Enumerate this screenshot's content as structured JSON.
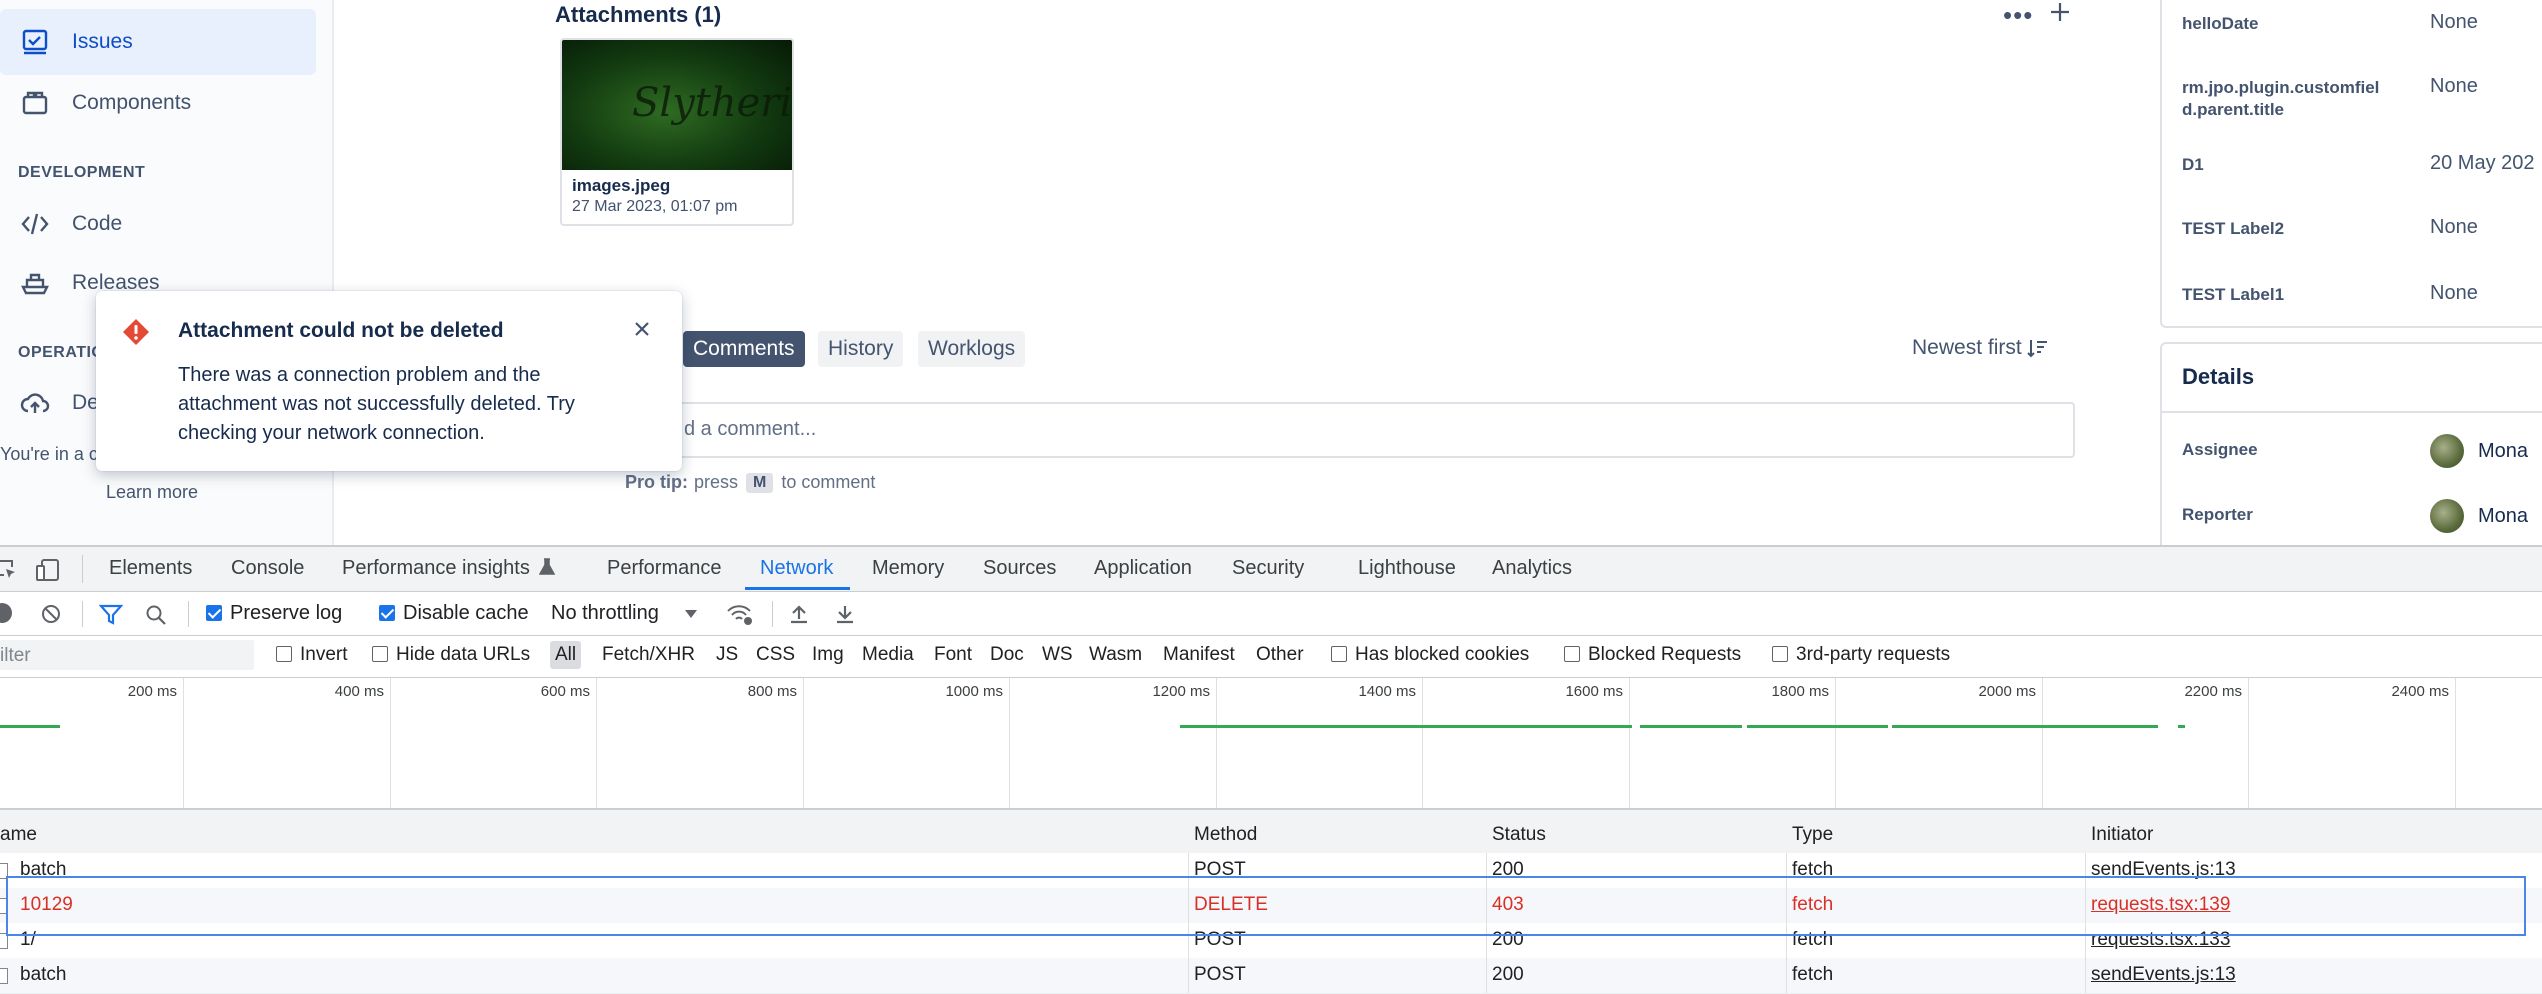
{
  "sidebar": {
    "items": [
      {
        "label": "Issues",
        "icon": "issues-icon",
        "active": true
      },
      {
        "label": "Components",
        "icon": "components-icon",
        "active": false
      },
      {
        "label": "Code",
        "icon": "code-icon",
        "active": false
      },
      {
        "label": "Releases",
        "icon": "releases-icon",
        "active": false
      },
      {
        "label": "De",
        "icon": "deployments-icon",
        "active": false
      }
    ],
    "sections": {
      "development": "DEVELOPMENT",
      "operations": "OPERATIO"
    },
    "footer_text": "You're in a c",
    "learn_more": "Learn more"
  },
  "attachments": {
    "title": "Attachments (1)",
    "items": [
      {
        "name": "images.jpeg",
        "date": "27 Mar 2023, 01:07 pm",
        "thumb_text": "Slytherin"
      }
    ]
  },
  "activity": {
    "tabs": [
      "Comments",
      "History",
      "Worklogs"
    ],
    "active_tab": "Comments",
    "sort": "Newest first",
    "comment_placeholder": "d a comment...",
    "pro_tip_label": "Pro tip:",
    "pro_tip_press": "press",
    "pro_tip_key": "M",
    "pro_tip_rest": "to comment"
  },
  "toast": {
    "title": "Attachment could not be deleted",
    "body": "There was a connection problem and the attachment was not successfully deleted. Try checking your network connection."
  },
  "fields": [
    {
      "label": "helloDate",
      "value": "None"
    },
    {
      "label": "rm.jpo.plugin.customfield.parent.title",
      "value": "None"
    },
    {
      "label": "D1",
      "value": "20 May 202"
    },
    {
      "label": "TEST Label2",
      "value": "None"
    },
    {
      "label": "TEST Label1",
      "value": "None"
    }
  ],
  "details": {
    "title": "Details",
    "assignee_label": "Assignee",
    "assignee": "Mona",
    "reporter_label": "Reporter",
    "reporter": "Mona"
  },
  "devtools": {
    "tabs": [
      "Elements",
      "Console",
      "Performance insights",
      "Performance",
      "Network",
      "Memory",
      "Sources",
      "Application",
      "Security",
      "Lighthouse",
      "Analytics"
    ],
    "active_tab": "Network",
    "toolbar": {
      "preserve_log": "Preserve log",
      "disable_cache": "Disable cache",
      "throttling": "No throttling"
    },
    "filter": {
      "placeholder": "ilter",
      "invert": "Invert",
      "hide_data_urls": "Hide data URLs",
      "types": [
        "All",
        "Fetch/XHR",
        "JS",
        "CSS",
        "Img",
        "Media",
        "Font",
        "Doc",
        "WS",
        "Wasm",
        "Manifest",
        "Other"
      ],
      "has_blocked_cookies": "Has blocked cookies",
      "blocked_requests": "Blocked Requests",
      "third_party": "3rd-party requests"
    },
    "timeline_ticks": [
      "200 ms",
      "400 ms",
      "600 ms",
      "800 ms",
      "1000 ms",
      "1200 ms",
      "1400 ms",
      "1600 ms",
      "1800 ms",
      "2000 ms",
      "2200 ms",
      "2400 ms"
    ],
    "columns": [
      "ame",
      "Method",
      "Status",
      "Type",
      "Initiator"
    ],
    "rows": [
      {
        "name": "batch",
        "method": "POST",
        "status": "200",
        "type": "fetch",
        "initiator": "sendEvents.js:13",
        "error": false
      },
      {
        "name": "10129",
        "method": "DELETE",
        "status": "403",
        "type": "fetch",
        "initiator": "requests.tsx:139",
        "error": true
      },
      {
        "name": "1/",
        "method": "POST",
        "status": "200",
        "type": "fetch",
        "initiator": "requests.tsx:133",
        "error": false
      },
      {
        "name": "batch",
        "method": "POST",
        "status": "200",
        "type": "fetch",
        "initiator": "sendEvents.js:13",
        "error": false
      }
    ]
  },
  "colors": {
    "accent": "#0c66e4",
    "error": "#d93025",
    "success": "#34a853",
    "toast_icon": "#e34935"
  }
}
